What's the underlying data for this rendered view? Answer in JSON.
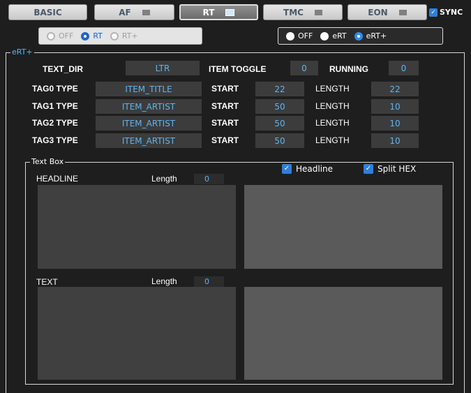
{
  "tabs": [
    {
      "label": "BASIC"
    },
    {
      "label": "AF"
    },
    {
      "label": "RT"
    },
    {
      "label": "TMC"
    },
    {
      "label": "EON"
    }
  ],
  "sync_label": "SYNC",
  "rt_mode": {
    "options": [
      "OFF",
      "RT",
      "RT+"
    ],
    "selected": "RT"
  },
  "ert_mode": {
    "options": [
      "OFF",
      "eRT",
      "eRT+"
    ],
    "selected": "eRT+"
  },
  "ertplus": {
    "group_title": "eRT+",
    "text_dir_label": "TEXT_DIR",
    "text_dir_value": "LTR",
    "item_toggle_label": "ITEM TOGGLE",
    "item_toggle_value": "0",
    "running_label": "RUNNING",
    "running_value": "0",
    "start_label": "START",
    "length_label": "LENGTH",
    "tags": [
      {
        "label": "TAG0 TYPE",
        "type": "ITEM_TITLE",
        "start": "22",
        "length": "22"
      },
      {
        "label": "TAG1 TYPE",
        "type": "ITEM_ARTIST",
        "start": "50",
        "length": "10"
      },
      {
        "label": "TAG2 TYPE",
        "type": "ITEM_ARTIST",
        "start": "50",
        "length": "10"
      },
      {
        "label": "TAG3 TYPE",
        "type": "ITEM_ARTIST",
        "start": "50",
        "length": "10"
      }
    ]
  },
  "textbox": {
    "group_title": "Text Box",
    "headline_checkbox": "Headline",
    "split_hex_checkbox": "Split HEX",
    "headline_label": "HEADLINE",
    "text_label": "TEXT",
    "length_label": "Length",
    "headline_length": "0",
    "text_length": "0"
  },
  "colors": {
    "accent": "#2f7fd8",
    "value_text": "#5fb4f0",
    "background": "#1e1e1e"
  }
}
